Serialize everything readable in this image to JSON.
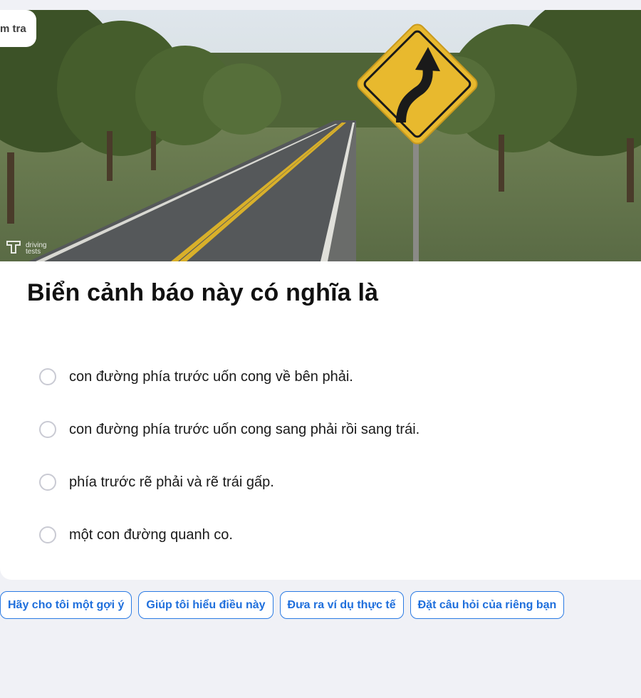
{
  "badge": {
    "label": "m tra"
  },
  "image": {
    "watermark": "driving tests",
    "sign_icon": "curve-right-warning-sign"
  },
  "question": {
    "title": "Biển cảnh báo này có nghĩa là"
  },
  "options": [
    {
      "label": "con đường phía trước uốn cong về bên phải."
    },
    {
      "label": "con đường phía trước uốn cong sang phải rồi sang trái."
    },
    {
      "label": "phía trước rẽ phải và rẽ trái gấp."
    },
    {
      "label": "một con đường quanh co."
    }
  ],
  "suggestions": [
    {
      "label": "Hãy cho tôi một gợi ý"
    },
    {
      "label": "Giúp tôi hiểu điều này"
    },
    {
      "label": "Đưa ra ví dụ thực tế"
    },
    {
      "label": "Đặt câu hỏi của riêng bạn"
    }
  ],
  "colors": {
    "accent": "#1f6fdc",
    "sign_yellow": "#e8b92e",
    "background": "#f0f1f6"
  }
}
